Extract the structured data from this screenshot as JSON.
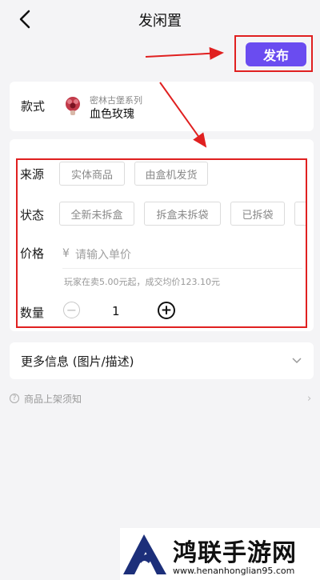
{
  "header": {
    "title": "发闲置",
    "publish_label": "发布"
  },
  "style_card": {
    "label": "款式",
    "series": "密林古堡系列",
    "name": "血色玫瑰"
  },
  "form": {
    "source": {
      "label": "来源",
      "options": [
        "实体商品",
        "由盒机发货"
      ]
    },
    "condition": {
      "label": "状态",
      "options": [
        "全新未拆盒",
        "拆盒未拆袋",
        "已拆袋"
      ]
    },
    "price": {
      "label": "价格",
      "symbol": "¥",
      "placeholder": "请输入单价",
      "hint": "玩家在卖5.00元起，成交均价123.10元"
    },
    "quantity": {
      "label": "数量",
      "value": "1"
    }
  },
  "more_info": {
    "label": "更多信息 (图片/描述)"
  },
  "notice": {
    "icon_text": "?",
    "text": "商品上架须知",
    "chevron": "›"
  },
  "watermark": {
    "title": "鸿联手游网",
    "url": "www.henanhonglian95.com"
  },
  "colors": {
    "accent": "#6a4cf0",
    "annotation": "#e02020",
    "background": "#f4f4f6"
  }
}
